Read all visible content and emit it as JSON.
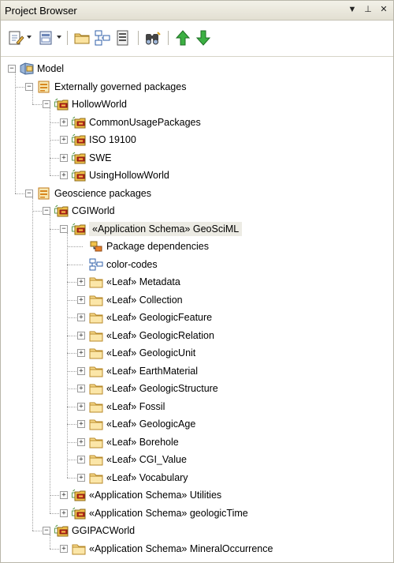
{
  "window": {
    "title": "Project Browser",
    "buttons": {
      "menu": "▼",
      "pin": "⊥",
      "close": "✕"
    }
  },
  "toolbar": {
    "tools": [
      {
        "name": "new-element-icon"
      },
      {
        "name": "new-diagram-icon"
      },
      {
        "name": "new-package-icon"
      },
      {
        "name": "view-diagram-icon"
      },
      {
        "name": "properties-icon"
      },
      {
        "name": "find-icon"
      },
      {
        "name": "move-up-icon"
      },
      {
        "name": "move-down-icon"
      }
    ]
  },
  "tree": {
    "nodes": [
      {
        "label": "Model",
        "icon": "model-root-icon",
        "level": 0,
        "expander": "minus"
      },
      {
        "label": "Externally governed packages",
        "icon": "view-package-icon",
        "level": 1,
        "expander": "minus"
      },
      {
        "label": "HollowWorld",
        "icon": "package-icon",
        "level": 2,
        "expander": "minus"
      },
      {
        "label": "CommonUsagePackages",
        "icon": "package-icon",
        "level": 3,
        "expander": "plus"
      },
      {
        "label": "ISO 19100",
        "icon": "package-icon",
        "level": 3,
        "expander": "plus"
      },
      {
        "label": "SWE",
        "icon": "package-icon",
        "level": 3,
        "expander": "plus"
      },
      {
        "label": "UsingHollowWorld",
        "icon": "package-icon",
        "level": 3,
        "expander": "plus"
      },
      {
        "label": "Geoscience packages",
        "icon": "view-package-icon",
        "level": 1,
        "expander": "minus"
      },
      {
        "label": "CGIWorld",
        "icon": "package-icon",
        "level": 2,
        "expander": "minus"
      },
      {
        "label": "«Application Schema» GeoSciML",
        "icon": "package-icon",
        "level": 3,
        "expander": "minus",
        "selected": true
      },
      {
        "label": "Package dependencies",
        "icon": "package-diagram-icon",
        "level": 4,
        "expander": "none"
      },
      {
        "label": "color-codes",
        "icon": "class-diagram-icon",
        "level": 4,
        "expander": "none"
      },
      {
        "label": "«Leaf» Metadata",
        "icon": "folder-icon",
        "level": 4,
        "expander": "plus"
      },
      {
        "label": "«Leaf» Collection",
        "icon": "folder-icon",
        "level": 4,
        "expander": "plus"
      },
      {
        "label": "«Leaf» GeologicFeature",
        "icon": "folder-icon",
        "level": 4,
        "expander": "plus"
      },
      {
        "label": "«Leaf» GeologicRelation",
        "icon": "folder-icon",
        "level": 4,
        "expander": "plus"
      },
      {
        "label": "«Leaf» GeologicUnit",
        "icon": "folder-icon",
        "level": 4,
        "expander": "plus"
      },
      {
        "label": "«Leaf» EarthMaterial",
        "icon": "folder-icon",
        "level": 4,
        "expander": "plus"
      },
      {
        "label": "«Leaf» GeologicStructure",
        "icon": "folder-icon",
        "level": 4,
        "expander": "plus"
      },
      {
        "label": "«Leaf» Fossil",
        "icon": "folder-icon",
        "level": 4,
        "expander": "plus"
      },
      {
        "label": "«Leaf» GeologicAge",
        "icon": "folder-icon",
        "level": 4,
        "expander": "plus"
      },
      {
        "label": "«Leaf» Borehole",
        "icon": "folder-icon",
        "level": 4,
        "expander": "plus"
      },
      {
        "label": "«Leaf» CGI_Value",
        "icon": "folder-icon",
        "level": 4,
        "expander": "plus"
      },
      {
        "label": "«Leaf» Vocabulary",
        "icon": "folder-icon",
        "level": 4,
        "expander": "plus"
      },
      {
        "label": "«Application Schema» Utilities",
        "icon": "package-icon",
        "level": 3,
        "expander": "plus"
      },
      {
        "label": "«Application Schema» geologicTime",
        "icon": "package-icon",
        "level": 3,
        "expander": "plus"
      },
      {
        "label": "GGIPACWorld",
        "icon": "package-icon",
        "level": 2,
        "expander": "minus"
      },
      {
        "label": "«Application Schema» MineralOccurrence",
        "icon": "folder-icon",
        "level": 3,
        "expander": "plus"
      }
    ]
  }
}
